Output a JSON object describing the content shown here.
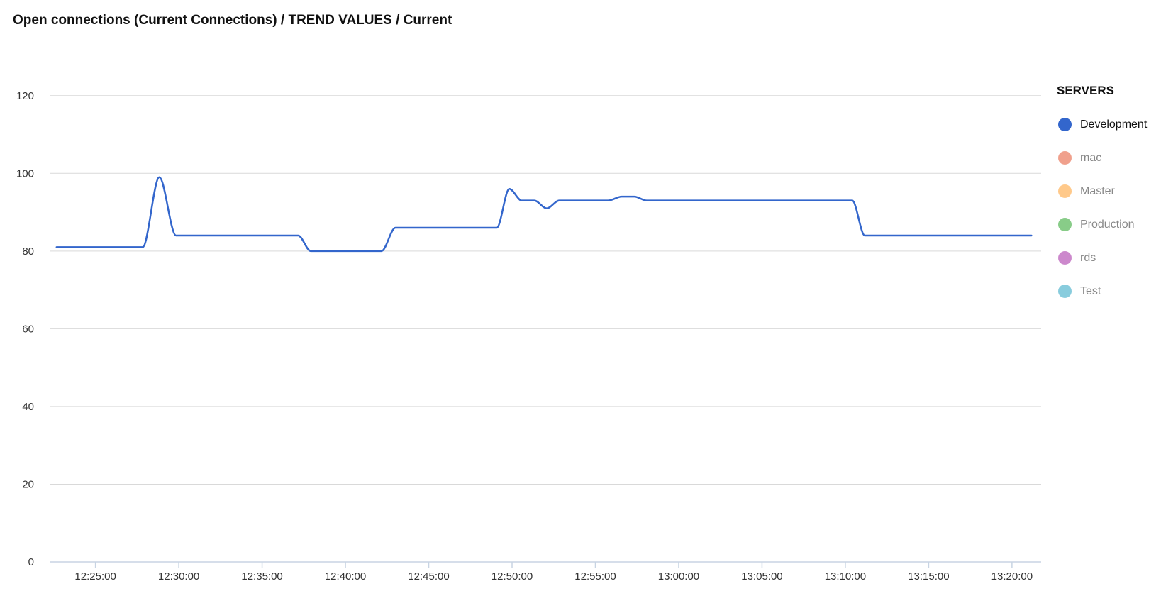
{
  "chart_data": {
    "type": "line",
    "title": "Open connections (Current Connections) / TREND VALUES / Current",
    "xlabel": "",
    "ylabel": "",
    "ylim": [
      0,
      130
    ],
    "yticks": [
      0,
      20,
      40,
      60,
      80,
      100,
      120
    ],
    "xlim": [
      "12:22:15",
      "13:21:45"
    ],
    "xticks": [
      "12:25:00",
      "12:30:00",
      "12:35:00",
      "12:40:00",
      "12:45:00",
      "12:50:00",
      "12:55:00",
      "13:00:00",
      "13:05:00",
      "13:10:00",
      "13:15:00",
      "13:20:00"
    ],
    "grid": true,
    "legend_title": "SERVERS",
    "legend_position": "right",
    "series": [
      {
        "name": "Development",
        "color": "#3366cc",
        "active": true,
        "x": [
          "12:22:40",
          "12:27:50",
          "12:28:50",
          "12:29:50",
          "12:37:10",
          "12:37:55",
          "12:42:10",
          "12:43:00",
          "12:49:05",
          "12:49:50",
          "12:50:35",
          "12:51:20",
          "12:52:05",
          "12:52:50",
          "12:53:35",
          "12:55:45",
          "12:56:35",
          "12:57:20",
          "12:58:05",
          "13:10:25",
          "13:11:10",
          "13:21:10"
        ],
        "values": [
          81,
          81,
          99,
          84,
          84,
          80,
          80,
          86,
          86,
          96,
          93,
          93,
          91,
          93,
          93,
          93,
          94,
          94,
          93,
          93,
          84,
          84
        ]
      },
      {
        "name": "mac",
        "color": "#f0a08c",
        "active": false,
        "x": [],
        "values": []
      },
      {
        "name": "Master",
        "color": "#ffc98a",
        "active": false,
        "x": [],
        "values": []
      },
      {
        "name": "Production",
        "color": "#88cc88",
        "active": false,
        "x": [],
        "values": []
      },
      {
        "name": "rds",
        "color": "#cc88cc",
        "active": false,
        "x": [],
        "values": []
      },
      {
        "name": "Test",
        "color": "#88ccdd",
        "active": false,
        "x": [],
        "values": []
      }
    ]
  }
}
